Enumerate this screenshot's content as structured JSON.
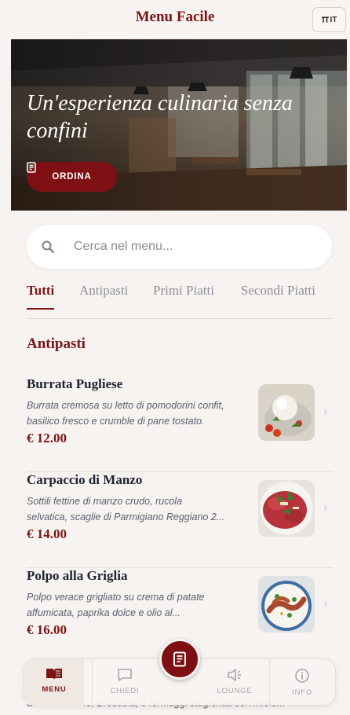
{
  "header": {
    "title": "Menu Facile",
    "language": "IT"
  },
  "hero": {
    "title": "Un'esperienza culinaria senza confini",
    "order_button": "ORDINA"
  },
  "search": {
    "placeholder": "Cerca nel menu..."
  },
  "tabs": [
    "Tutti",
    "Antipasti",
    "Primi Piatti",
    "Secondi Piatti"
  ],
  "active_tab": "Tutti",
  "section": {
    "title": "Antipasti"
  },
  "dishes": [
    {
      "name": "Burrata Pugliese",
      "desc_line1": "Burrata cremosa su letto di pomodorini confit,",
      "desc_line2": "basilico fresco e crumble di pane tostato.",
      "price": "€ 12.00"
    },
    {
      "name": "Carpaccio di Manzo",
      "desc_line1": "Sottili fettine di manzo crudo, rucola",
      "desc_line2": "selvatica, scaglie di Parmigiano Reggiano 2...",
      "price": "€ 14.00"
    },
    {
      "name": "Polpo alla Griglia",
      "desc_line1": "Polpo verace grigliato su crema di patate",
      "desc_line2": "affumicata, paprika dolce e olio al...",
      "price": "€ 16.00"
    }
  ],
  "peek_text": "Salame Milano, Bresaola, e formaggi stagionati con miele...",
  "bottom_nav": [
    {
      "label": "MENU",
      "icon": "book-icon",
      "active": true
    },
    {
      "label": "CHIEDI",
      "icon": "chat-icon",
      "active": false
    },
    {
      "label": "LOUNGE",
      "icon": "speaker-icon",
      "active": false
    },
    {
      "label": "INFO",
      "icon": "info-icon",
      "active": false
    }
  ],
  "colors": {
    "accent": "#7b1515",
    "background": "#f6f3f0"
  }
}
